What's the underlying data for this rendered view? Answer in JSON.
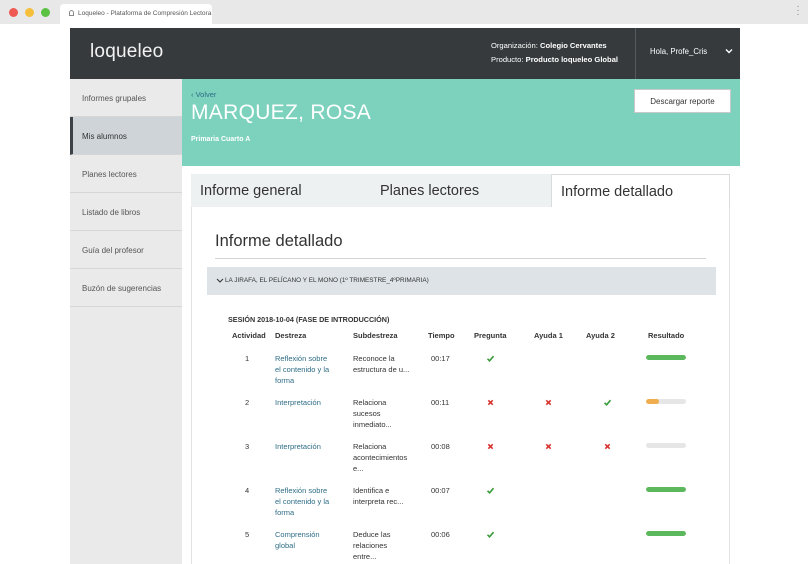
{
  "browser": {
    "tab_title": "Loqueleo - Plataforma de Compresión Lectora"
  },
  "header": {
    "logo": "loqueleo",
    "org_label": "Organización:",
    "org_value": "Colegio Cervantes",
    "product_label": "Producto:",
    "product_value": "Producto loqueleo Global",
    "greeting": "Hola, Profe_Cris"
  },
  "sidebar": {
    "items": [
      {
        "label": "Informes grupales"
      },
      {
        "label": "Mis alumnos",
        "active": true
      },
      {
        "label": "Planes lectores"
      },
      {
        "label": "Listado de libros"
      },
      {
        "label": "Guía del profesor"
      },
      {
        "label": "Buzón de sugerencias"
      }
    ]
  },
  "hero": {
    "back": "‹ Volver",
    "student_name": "MARQUEZ, ROSA",
    "class_name": "Primaria Cuarto A",
    "download_label": "Descargar reporte"
  },
  "tabs": [
    {
      "label": "Informe general"
    },
    {
      "label": "Planes lectores"
    },
    {
      "label": "Informe detallado",
      "active": true
    }
  ],
  "report": {
    "title": "Informe detallado",
    "book_title": "LA JIRAFA, EL PELÍCANO Y EL MONO (1º TRIMESTRE_4ºPRIMARIA)",
    "session_title": "SESIÓN 2018-10-04 (FASE DE INTRODUCCIÓN)",
    "columns": [
      "Actividad",
      "Destreza",
      "Subdestreza",
      "Tiempo",
      "Pregunta",
      "Ayuda 1",
      "Ayuda 2",
      "Resultado"
    ],
    "rows": [
      {
        "actividad": "1",
        "destreza": [
          "Reflexión sobre",
          "el contenido y la",
          "forma"
        ],
        "subdestreza": [
          "Reconoce la",
          "estructura de u..."
        ],
        "tiempo": "00:17",
        "pregunta": "check",
        "ayuda1": "",
        "ayuda2": "",
        "resultado": 1.0,
        "resultado_color": "#5cb85c"
      },
      {
        "actividad": "2",
        "destreza": [
          "Interpretación"
        ],
        "subdestreza": [
          "Relaciona",
          "sucesos",
          "inmediato..."
        ],
        "tiempo": "00:11",
        "pregunta": "cross",
        "ayuda1": "cross",
        "ayuda2": "check",
        "resultado": 0.33,
        "resultado_color": "#f0ad4e"
      },
      {
        "actividad": "3",
        "destreza": [
          "Interpretación"
        ],
        "subdestreza": [
          "Relaciona",
          "acontecimientos",
          "e..."
        ],
        "tiempo": "00:08",
        "pregunta": "cross",
        "ayuda1": "cross",
        "ayuda2": "cross",
        "resultado": 0.0,
        "resultado_color": "#5cb85c"
      },
      {
        "actividad": "4",
        "destreza": [
          "Reflexión sobre",
          "el contenido y la",
          "forma"
        ],
        "subdestreza": [
          "Identifica e",
          "interpreta rec..."
        ],
        "tiempo": "00:07",
        "pregunta": "check",
        "ayuda1": "",
        "ayuda2": "",
        "resultado": 1.0,
        "resultado_color": "#5cb85c"
      },
      {
        "actividad": "5",
        "destreza": [
          "Comprensión",
          "global"
        ],
        "subdestreza": [
          "Deduce las",
          "relaciones",
          "entre..."
        ],
        "tiempo": "00:06",
        "pregunta": "check",
        "ayuda1": "",
        "ayuda2": "",
        "resultado": 1.0,
        "resultado_color": "#5cb85c"
      }
    ]
  },
  "colors": {
    "check": "#3a9b3a",
    "cross": "#d9322e",
    "hero": "#7dd2be",
    "header": "#363a3d"
  }
}
